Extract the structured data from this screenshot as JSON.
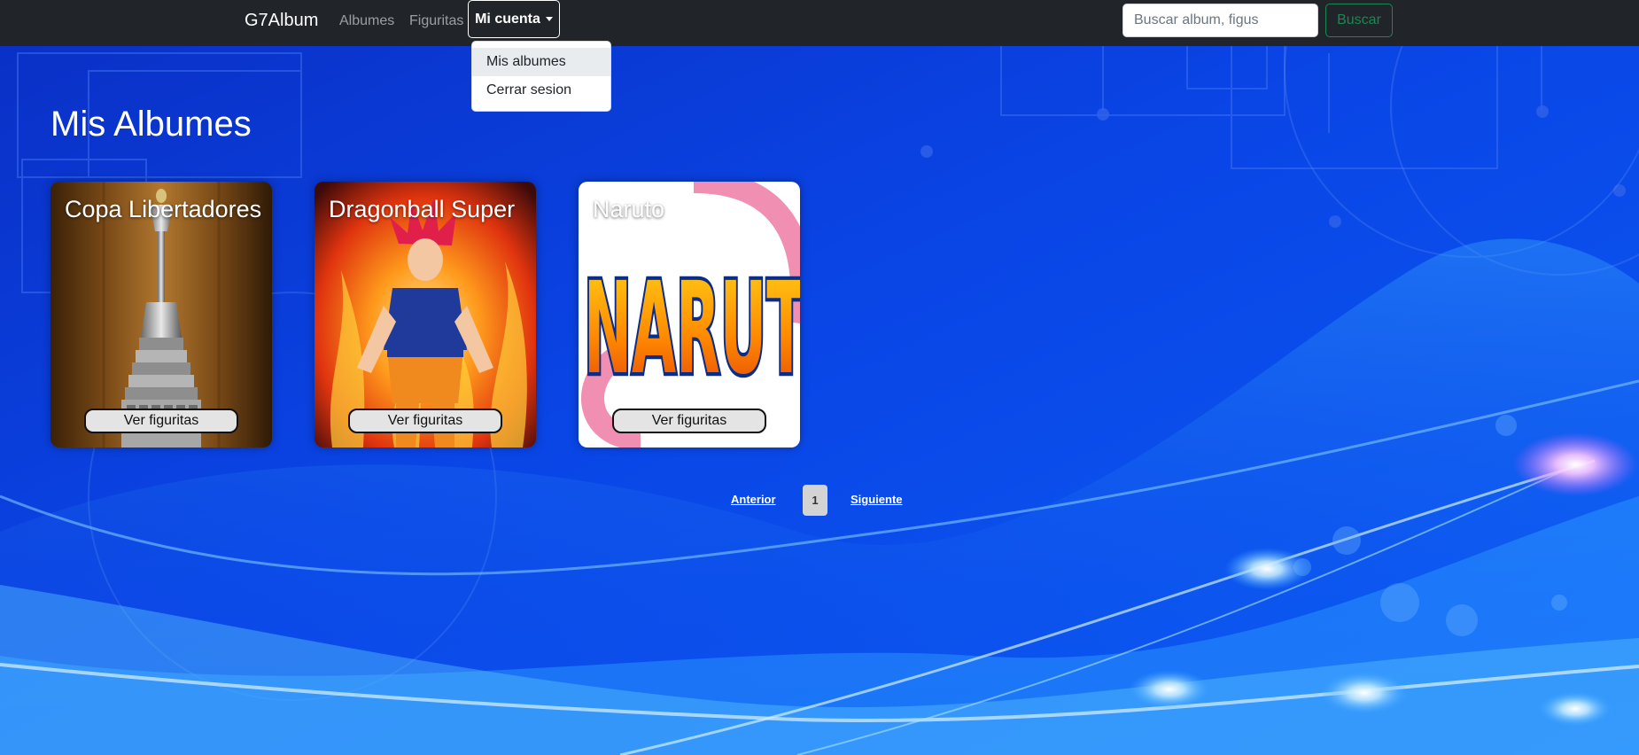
{
  "navbar": {
    "brand": "G7Album",
    "links": [
      {
        "label": "Albumes"
      },
      {
        "label": "Figuritas"
      }
    ],
    "account_label": "Mi cuenta",
    "search": {
      "placeholder": "Buscar album, figus",
      "value": ""
    },
    "search_button": "Buscar"
  },
  "account_menu": {
    "items": [
      {
        "label": "Mis albumes",
        "active": true
      },
      {
        "label": "Cerrar sesion",
        "active": false
      }
    ]
  },
  "main": {
    "title": "Mis Albumes",
    "albums": [
      {
        "title": "Copa Libertadores",
        "button": "Ver figuritas"
      },
      {
        "title": "Dragonball Super",
        "button": "Ver figuritas"
      },
      {
        "title": "Naruto",
        "button": "Ver figuritas",
        "art_text": "NARUTO"
      }
    ]
  },
  "pagination": {
    "prev": "Anterior",
    "current": "1",
    "next": "Siguiente"
  },
  "colors": {
    "navbar_bg": "#212529",
    "background": "#0a3fd8",
    "search_button": "#198754"
  }
}
